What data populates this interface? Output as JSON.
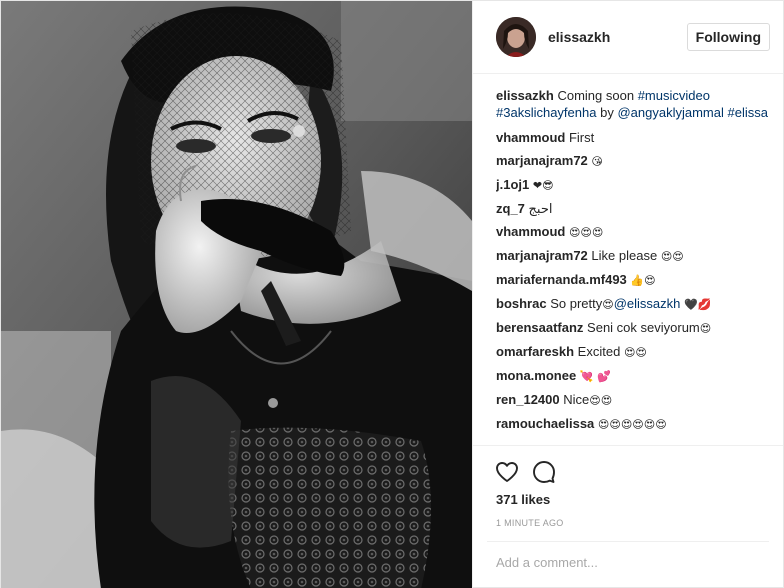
{
  "post": {
    "username": "elissazkh",
    "follow_label": "Following",
    "caption": {
      "user": "elissazkh",
      "text": "Coming soon",
      "tag1": "#musicvideo",
      "tag2": "#3akslichayfenha",
      "by": "by",
      "mention": "@angyaklyjammal",
      "tag3": "#elissa"
    },
    "comments": [
      {
        "user": "vhammoud",
        "text": "First",
        "emoji": ""
      },
      {
        "user": "marjanajram72",
        "text": "",
        "emoji": "😘"
      },
      {
        "user": "j.1oj1",
        "text": "",
        "emoji": "❤😎"
      },
      {
        "user": "zq_7",
        "text": "احبج",
        "emoji": ""
      },
      {
        "user": "vhammoud",
        "text": "",
        "emoji": "😍😍😍"
      },
      {
        "user": "marjanajram72",
        "text": "Like please",
        "emoji": "😍😍"
      },
      {
        "user": "mariafernanda.mf493",
        "text": "",
        "emoji": "👍😍"
      },
      {
        "user": "boshrac",
        "text": "So pretty",
        "emoji": "😍",
        "mention": "@elissazkh",
        "emoji2": "🖤💋"
      },
      {
        "user": "berensaatfanz",
        "text": "Seni cok seviyorum",
        "emoji": "😍"
      },
      {
        "user": "omarfareskh",
        "text": "Excited",
        "emoji": "😍😍"
      },
      {
        "user": "mona.monee",
        "text": "",
        "emoji": "💘 💕"
      },
      {
        "user": "ren_12400",
        "text": "Nice",
        "emoji": "😍😍"
      },
      {
        "user": "ramouchaelissa",
        "text": "",
        "emoji": "😍😍😍😍😍😍"
      }
    ],
    "likes": "371 likes",
    "timestamp": "1 MINUTE AGO",
    "add_comment_placeholder": "Add a comment...",
    "icons": {
      "like": "heart-outline-icon",
      "comment": "speech-bubble-icon"
    }
  }
}
